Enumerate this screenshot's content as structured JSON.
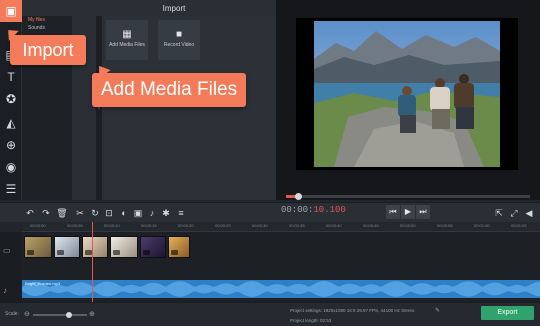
{
  "import_panel": {
    "title": "Import",
    "folders": [
      "My files",
      "Sounds"
    ],
    "tiles": [
      {
        "label": "Add Media Files",
        "icon": "film-plus-icon"
      },
      {
        "label": "Record Video",
        "icon": "camera-icon"
      }
    ]
  },
  "callouts": {
    "import": "Import",
    "add_media": "Add Media Files"
  },
  "player": {
    "time_elapsed": "00:00:",
    "time_current": "10.100",
    "progress": 0.05
  },
  "timeline": {
    "ruler_ticks": [
      "00:00:00",
      "00:00:05",
      "00:00:10",
      "00:00:15",
      "00:00:20",
      "00:00:25",
      "00:00:30",
      "00:00:35",
      "00:00:40",
      "00:00:45",
      "00:00:50",
      "00:00:55",
      "00:01:00",
      "00:01:05"
    ],
    "audio_label": "Bright_Kuznen.mp3"
  },
  "status": {
    "scale_label": "Scale:",
    "project_settings": "Project settings:  1920x1080 16:9 29.97 FPS, 44100 Hz Stereo",
    "project_length": "Project length:    02:53",
    "export_label": "Export"
  },
  "colors": {
    "accent": "#f47b5a",
    "export": "#2fa36b",
    "audio": "#2f7fc7",
    "playhead": "#e2564f"
  }
}
